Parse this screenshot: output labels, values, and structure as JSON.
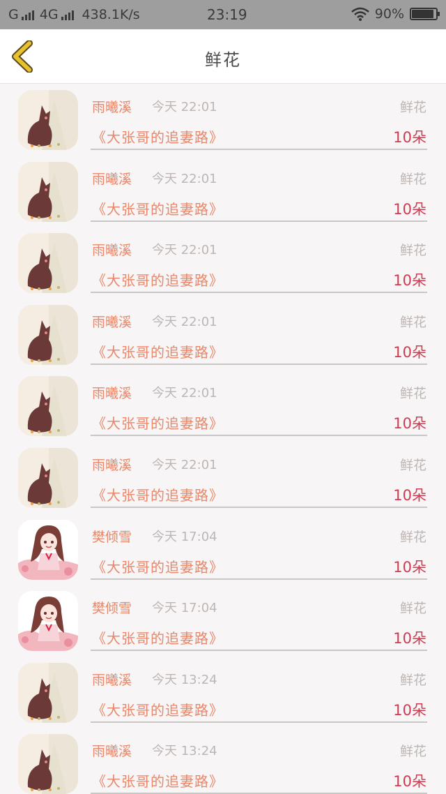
{
  "status_bar": {
    "network_left": "G",
    "network_right": "4G",
    "speed": "438.1K/s",
    "time": "23:19",
    "battery": "90%",
    "battery_level": 0.9
  },
  "header": {
    "title": "鲜花"
  },
  "colors": {
    "name": "#e8876a",
    "muted": "#bdb6b4",
    "count": "#d23a52",
    "back_arrow": "#e7c12f"
  },
  "items": [
    {
      "avatar": "cat-avatar",
      "name": "雨曦溪",
      "time": "今天 22:01",
      "type": "鲜花",
      "book": "《大张哥的追妻路》",
      "count": "10朵"
    },
    {
      "avatar": "cat-avatar",
      "name": "雨曦溪",
      "time": "今天 22:01",
      "type": "鲜花",
      "book": "《大张哥的追妻路》",
      "count": "10朵"
    },
    {
      "avatar": "cat-avatar",
      "name": "雨曦溪",
      "time": "今天 22:01",
      "type": "鲜花",
      "book": "《大张哥的追妻路》",
      "count": "10朵"
    },
    {
      "avatar": "cat-avatar",
      "name": "雨曦溪",
      "time": "今天 22:01",
      "type": "鲜花",
      "book": "《大张哥的追妻路》",
      "count": "10朵"
    },
    {
      "avatar": "cat-avatar",
      "name": "雨曦溪",
      "time": "今天 22:01",
      "type": "鲜花",
      "book": "《大张哥的追妻路》",
      "count": "10朵"
    },
    {
      "avatar": "cat-avatar",
      "name": "雨曦溪",
      "time": "今天 22:01",
      "type": "鲜花",
      "book": "《大张哥的追妻路》",
      "count": "10朵"
    },
    {
      "avatar": "girl-avatar",
      "name": "樊倾雪",
      "time": "今天 17:04",
      "type": "鲜花",
      "book": "《大张哥的追妻路》",
      "count": "10朵"
    },
    {
      "avatar": "girl-avatar",
      "name": "樊倾雪",
      "time": "今天 17:04",
      "type": "鲜花",
      "book": "《大张哥的追妻路》",
      "count": "10朵"
    },
    {
      "avatar": "cat-avatar",
      "name": "雨曦溪",
      "time": "今天 13:24",
      "type": "鲜花",
      "book": "《大张哥的追妻路》",
      "count": "10朵"
    },
    {
      "avatar": "cat-avatar",
      "name": "雨曦溪",
      "time": "今天 13:24",
      "type": "鲜花",
      "book": "《大张哥的追妻路》",
      "count": "10朵"
    }
  ]
}
